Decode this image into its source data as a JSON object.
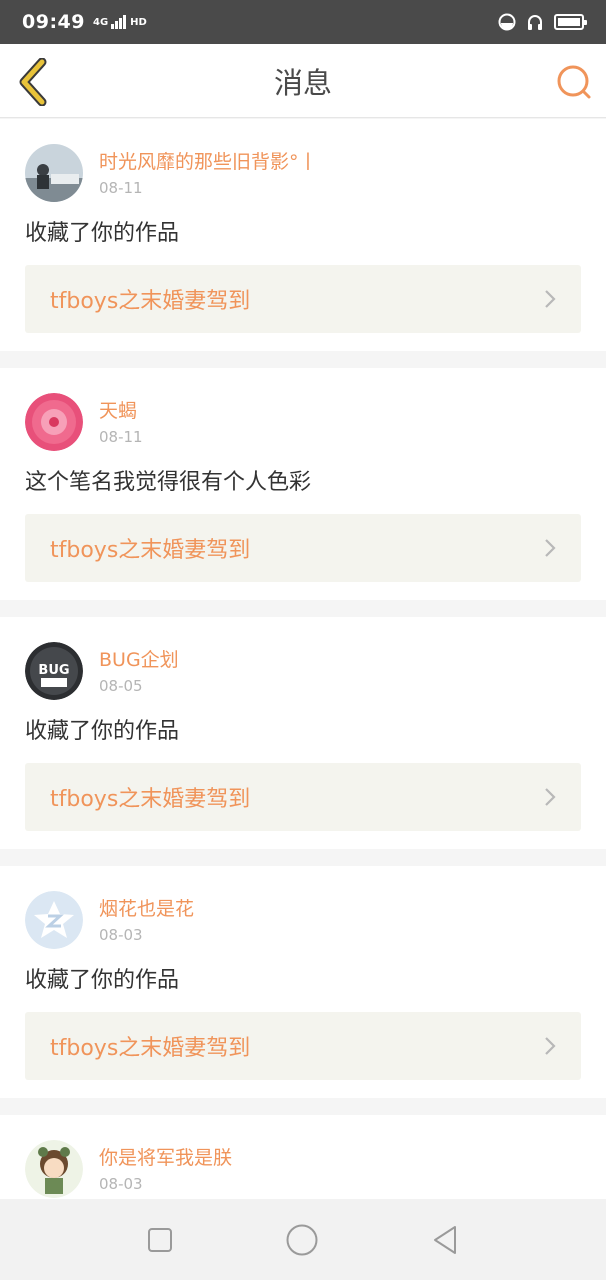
{
  "status_bar": {
    "time": "09:49",
    "network": "4G",
    "hd": "HD"
  },
  "header": {
    "title": "消息"
  },
  "messages": [
    {
      "user": "时光风靡的那些旧背影°丨",
      "date": "08-11",
      "text": "收藏了你的作品",
      "work": "tfboys之末婚妻驾到"
    },
    {
      "user": "天蝎",
      "date": "08-11",
      "text": "这个笔名我觉得很有个人色彩",
      "work": "tfboys之末婚妻驾到"
    },
    {
      "user": "BUG企划",
      "date": "08-05",
      "text": "收藏了你的作品",
      "work": "tfboys之末婚妻驾到",
      "avatar_text": "BUG"
    },
    {
      "user": "烟花也是花",
      "date": "08-03",
      "text": "收藏了你的作品",
      "work": "tfboys之末婚妻驾到"
    },
    {
      "user": "你是将军我是朕",
      "date": "08-03"
    }
  ],
  "colors": {
    "accent": "#f0945a",
    "back_arrow": "#e8c33a",
    "status_bg": "#4a4a4a"
  }
}
